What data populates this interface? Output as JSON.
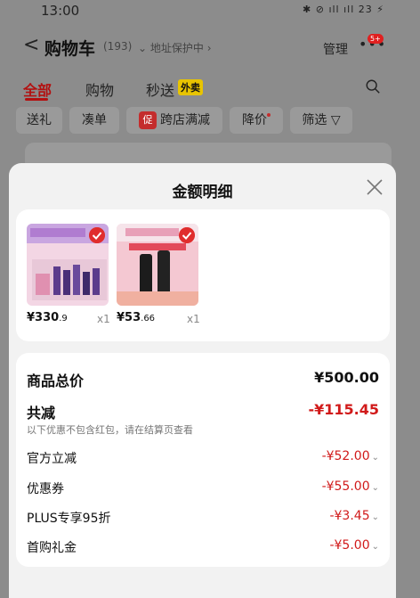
{
  "status_bar": {
    "time": "13:00",
    "icons_text": "✱ ⊘ ıll ıll 23 ⚡"
  },
  "header": {
    "title": "购物车",
    "count": "(193)",
    "address": "地址保护中",
    "manage": "管理",
    "badge": "5+"
  },
  "tabs": [
    {
      "label": "全部"
    },
    {
      "label": "购物"
    },
    {
      "label": "秒送"
    }
  ],
  "tab_tag": "外卖",
  "filters": [
    {
      "label": "送礼"
    },
    {
      "label": "凑单"
    },
    {
      "label": "跨店满减",
      "tag": "促"
    },
    {
      "label": "降价"
    },
    {
      "label": "筛选"
    }
  ],
  "sheet": {
    "title": "金额明细"
  },
  "products": [
    {
      "price_main": "¥330",
      "price_dec": ".9",
      "qty": "x1"
    },
    {
      "price_main": "¥53",
      "price_dec": ".66",
      "qty": "x1"
    }
  ],
  "details": {
    "total_label": "商品总价",
    "total_value": "¥500.00",
    "reduce_label": "共减",
    "reduce_value": "-¥115.45",
    "reduce_note": "以下优惠不包含红包，请在结算页查看",
    "items": [
      {
        "label": "官方立减",
        "value": "-¥52.00"
      },
      {
        "label": "优惠券",
        "value": "-¥55.00"
      },
      {
        "label": "PLUS专享95折",
        "value": "-¥3.45"
      },
      {
        "label": "首购礼金",
        "value": "-¥5.00"
      }
    ]
  }
}
